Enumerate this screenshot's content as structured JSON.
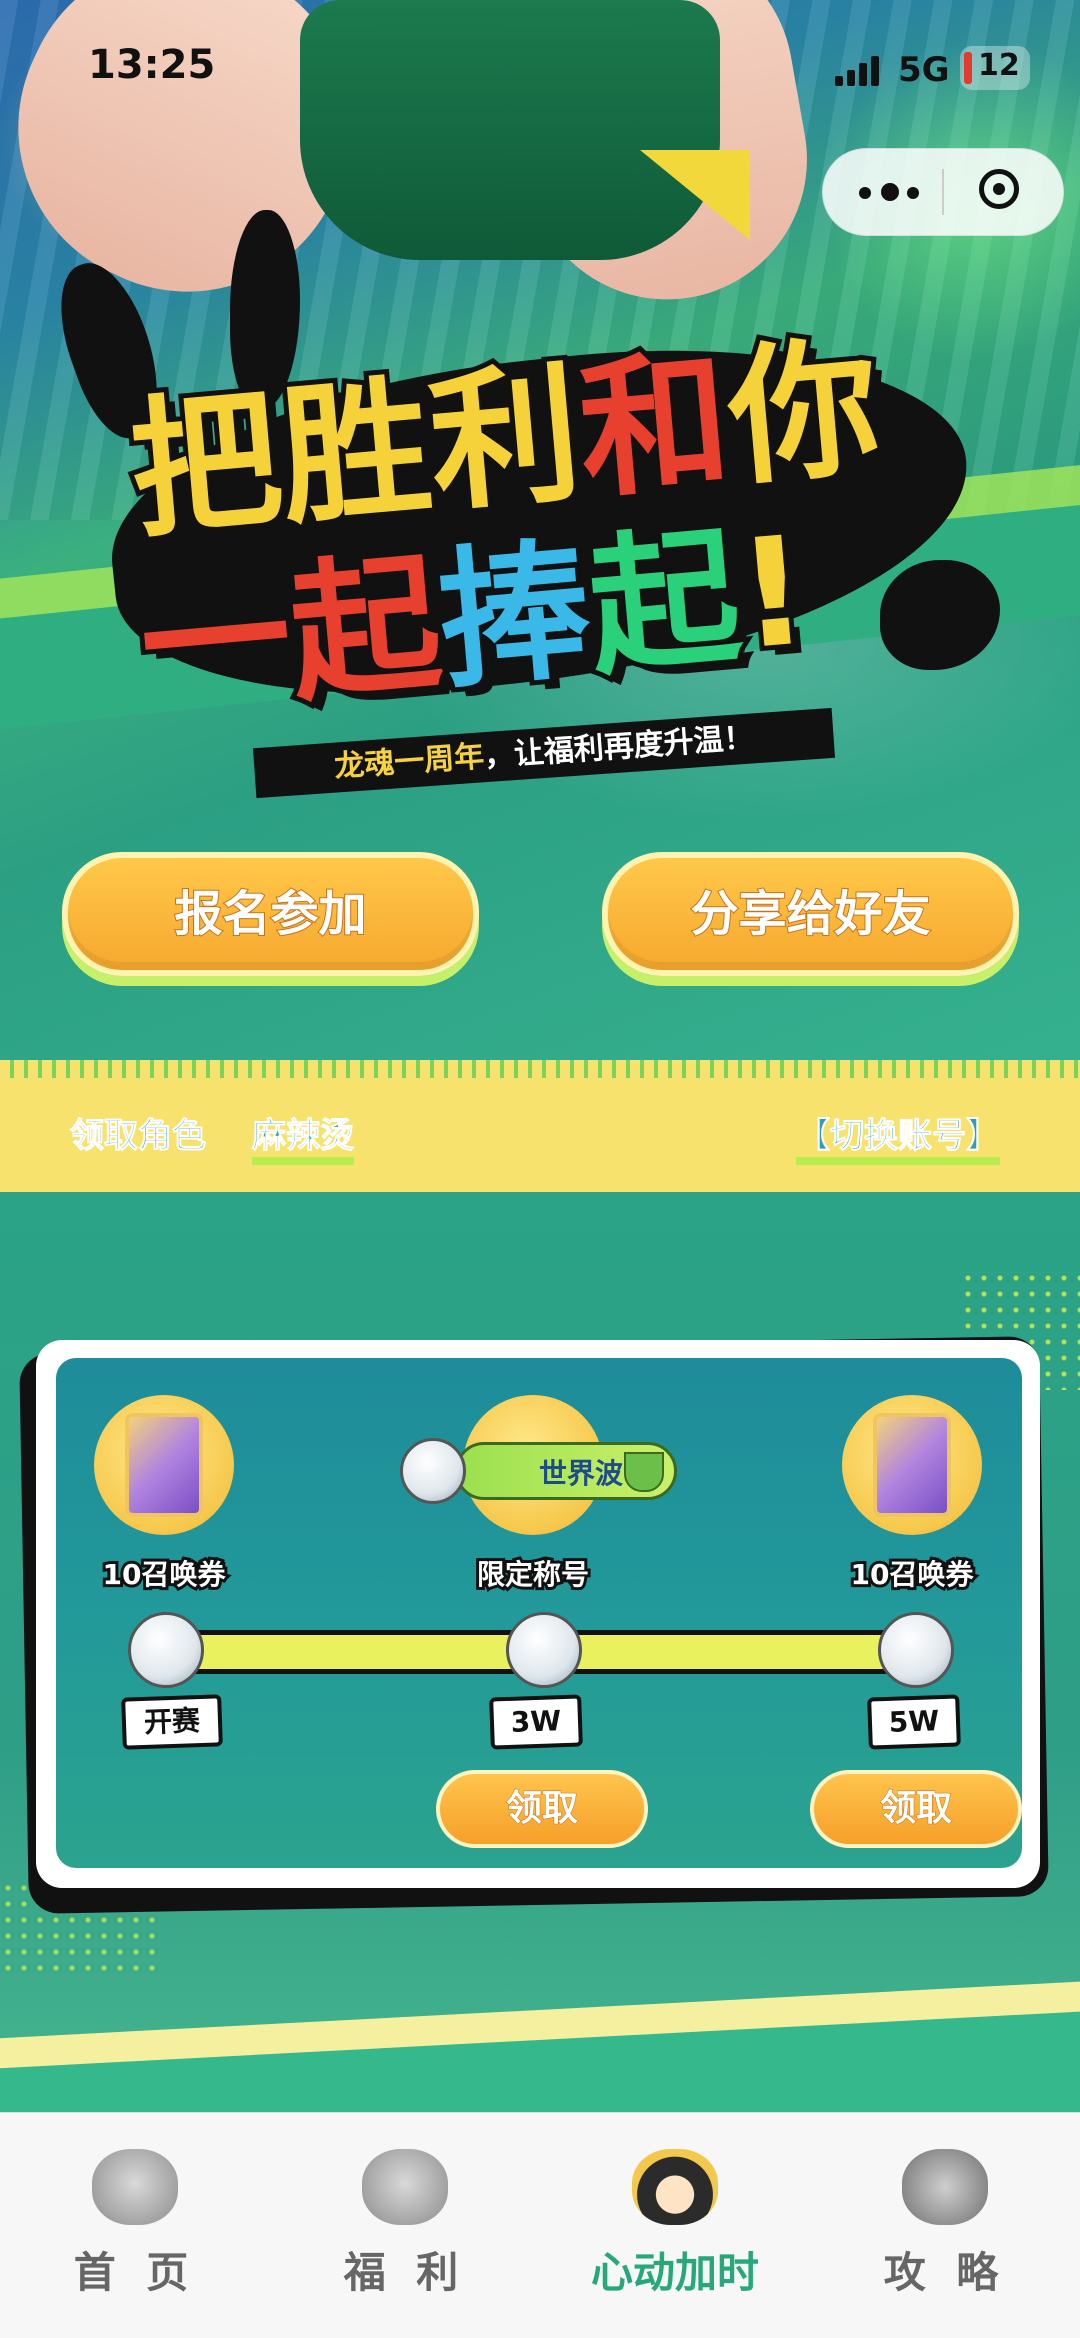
{
  "status_bar": {
    "time": "13:25",
    "network": "5G",
    "battery": "12"
  },
  "hero": {
    "title_line1": [
      "把",
      "胜",
      "利",
      "和",
      "你"
    ],
    "title_line1_colors": [
      "#f6d23a",
      "#f6d23a",
      "#f6d23a",
      "#e8402f",
      "#f6d23a"
    ],
    "title_line2": [
      "一",
      "起",
      "捧",
      "起",
      "!"
    ],
    "title_line2_colors": [
      "#e8402f",
      "#e8402f",
      "#3ab8e8",
      "#2bd07a",
      "#f6d23a"
    ],
    "subtitle_highlight": "龙魂一周年",
    "subtitle_rest": "，让福利再度升温！"
  },
  "actions": {
    "signup": "报名参加",
    "share": "分享给好友"
  },
  "account": {
    "role_label": "领取角色",
    "role_name": "麻辣烫",
    "switch": "【切换账号】"
  },
  "rewards": {
    "items": [
      {
        "label": "10召唤券",
        "icon": "summon-card-icon"
      },
      {
        "label": "限定称号",
        "icon": "title-badge-icon",
        "badge": "世界波"
      },
      {
        "label": "10召唤券",
        "icon": "summon-card-icon"
      }
    ],
    "milestones": [
      "开赛",
      "3W",
      "5W"
    ],
    "claim": "领取"
  },
  "tabs": [
    {
      "label": "首 页",
      "icon": "mascot-home-icon"
    },
    {
      "label": "福 利",
      "icon": "mascot-welfare-icon"
    },
    {
      "label": "心动加时",
      "icon": "character-avatar-icon",
      "active": true
    },
    {
      "label": "攻 略",
      "icon": "mascot-guide-icon"
    }
  ],
  "colors": {
    "accent_green": "#27a87a",
    "button_orange": "#f6a82e",
    "account_bar": "#f7e26e"
  }
}
